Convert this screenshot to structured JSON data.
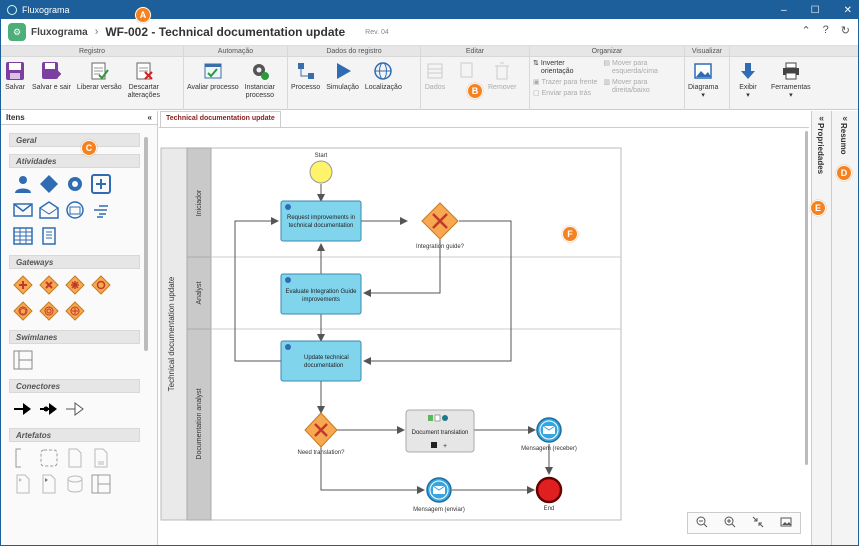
{
  "window": {
    "title": "Fluxograma",
    "minimize": "–",
    "maximize": "☐",
    "close": "✕"
  },
  "header": {
    "app": "Fluxograma",
    "separator": "›",
    "title": "WF-002 - Technical documentation update",
    "revision": "Rev. 04",
    "logo": "⚙",
    "right_icons": [
      "⌃",
      "?",
      "↻"
    ]
  },
  "ribbon": {
    "groups": {
      "registro": "Registro",
      "automacao": "Automação",
      "dados": "Dados do registro",
      "editar": "Editar",
      "organizar": "Organizar",
      "visualizar": "Visualizar"
    },
    "buttons": {
      "salvar": "Salvar",
      "salvar_sair": "Salvar e sair",
      "liberar": "Liberar versão",
      "descartar1": "Descartar",
      "descartar2": "alterações",
      "avaliar": "Avaliar processo",
      "instanciar1": "Instanciar",
      "instanciar2": "processo",
      "processo": "Processo",
      "simulacao": "Simulação",
      "localizacao": "Localização",
      "dados": "Dados",
      "remover": "Remover",
      "inverter1": "Inverter",
      "inverter2": "orientação",
      "trazer": "Trazer para frente",
      "enviar": "Enviar para trás",
      "mover_esq1": "Mover para",
      "mover_esq2": "esquerda/cima",
      "mover_dir1": "Mover para",
      "mover_dir2": "direita/baixo",
      "diagrama": "Diagrama",
      "exibir": "Exibir",
      "ferramentas": "Ferramentas"
    }
  },
  "markers": {
    "a": "A",
    "b": "B",
    "c": "C",
    "d": "D",
    "e": "E",
    "f": "F"
  },
  "left_panel": {
    "title": "Itens",
    "collapse": "«",
    "sections": {
      "geral": "Geral",
      "atividades": "Atividades",
      "gateways": "Gateways",
      "swimlanes": "Swimlanes",
      "conectores": "Conectores",
      "artefatos": "Artefatos"
    }
  },
  "canvas": {
    "tab": "Technical documentation update"
  },
  "right_panels": {
    "properties": "Propriedades",
    "resumo": "Resumo",
    "collapse": "«"
  },
  "diagram": {
    "pool": "Technical documentation update",
    "lanes": [
      "Iniciador",
      "Analyst",
      "Documentation analyst"
    ],
    "start": "Start",
    "task1": [
      "Request improvements in",
      "technical documentation"
    ],
    "gw1": "Integration guide?",
    "task2": [
      "Evaluate Integration Guide",
      "improvements"
    ],
    "task3": [
      "Update technical",
      "documentation"
    ],
    "gw2": "Need translation?",
    "subprocess": "Document translation",
    "msg_receive": "Mensagem (receber)",
    "msg_send": "Mensagem (enviar)",
    "end": "End"
  },
  "colors": {
    "titlebar": "#1c5f9a",
    "task": "#80d4ec",
    "gateway": "#f7a850",
    "event_start": "#fef36a",
    "event_end": "#e02020",
    "marker": "#f58220"
  }
}
